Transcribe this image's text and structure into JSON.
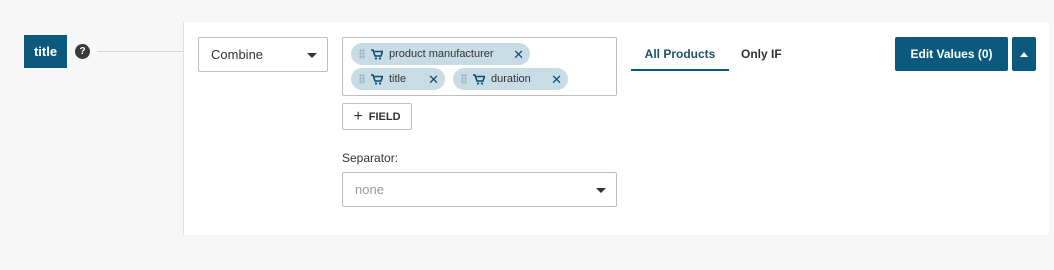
{
  "field": {
    "name": "title",
    "help_glyph": "?"
  },
  "mode_select": {
    "value": "Combine"
  },
  "fields": [
    {
      "label": "product manufacturer",
      "icon": "cart-icon"
    },
    {
      "label": "title",
      "icon": "cart-icon"
    },
    {
      "label": "duration",
      "icon": "cart-icon"
    }
  ],
  "add_field": {
    "plus": "+",
    "label": "FIELD"
  },
  "separator": {
    "label": "Separator:",
    "placeholder": "none"
  },
  "tabs": [
    {
      "label": "All Products",
      "active": true
    },
    {
      "label": "Only IF",
      "active": false
    }
  ],
  "edit_values_label": "Edit Values (0)",
  "colors": {
    "brand": "#0b5a7e",
    "chip": "#c8dce6",
    "background": "#f7f7f7"
  }
}
